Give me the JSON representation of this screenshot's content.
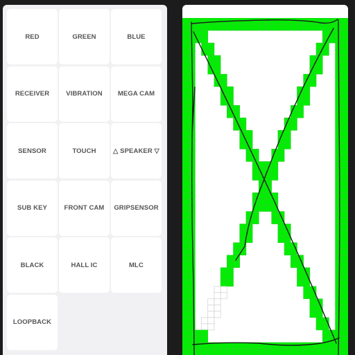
{
  "menu": {
    "buttons": [
      {
        "id": "red",
        "label": "RED"
      },
      {
        "id": "green",
        "label": "GREEN"
      },
      {
        "id": "blue",
        "label": "BLUE"
      },
      {
        "id": "receiver",
        "label": "RECEIVER"
      },
      {
        "id": "vibration",
        "label": "VIBRATION"
      },
      {
        "id": "mega-cam",
        "label": "MEGA CAM"
      },
      {
        "id": "sensor",
        "label": "SENSOR"
      },
      {
        "id": "touch",
        "label": "TOUCH"
      },
      {
        "id": "speaker",
        "label": "△ SPEAKER ▽"
      },
      {
        "id": "sub-key",
        "label": "SUB KEY"
      },
      {
        "id": "front-cam",
        "label": "FRONT CAM"
      },
      {
        "id": "gripsensor",
        "label": "GRIPSENSOR"
      },
      {
        "id": "black",
        "label": "BLACK"
      },
      {
        "id": "hall-ic",
        "label": "HALL IC"
      },
      {
        "id": "mlc",
        "label": "MLC"
      },
      {
        "id": "loopback",
        "label": "LOOPBACK"
      }
    ]
  },
  "touch_test": {
    "pattern": "border-and-x",
    "colors": {
      "passed_cell": "#00ee00",
      "pending_cell_border": "#c8c8c8",
      "grid_line": "#33cc33",
      "trace": "#1a1a1a",
      "background": "#ffffff"
    },
    "pending_cells_note": "7 unfilled cells on lower-left diagonal"
  }
}
